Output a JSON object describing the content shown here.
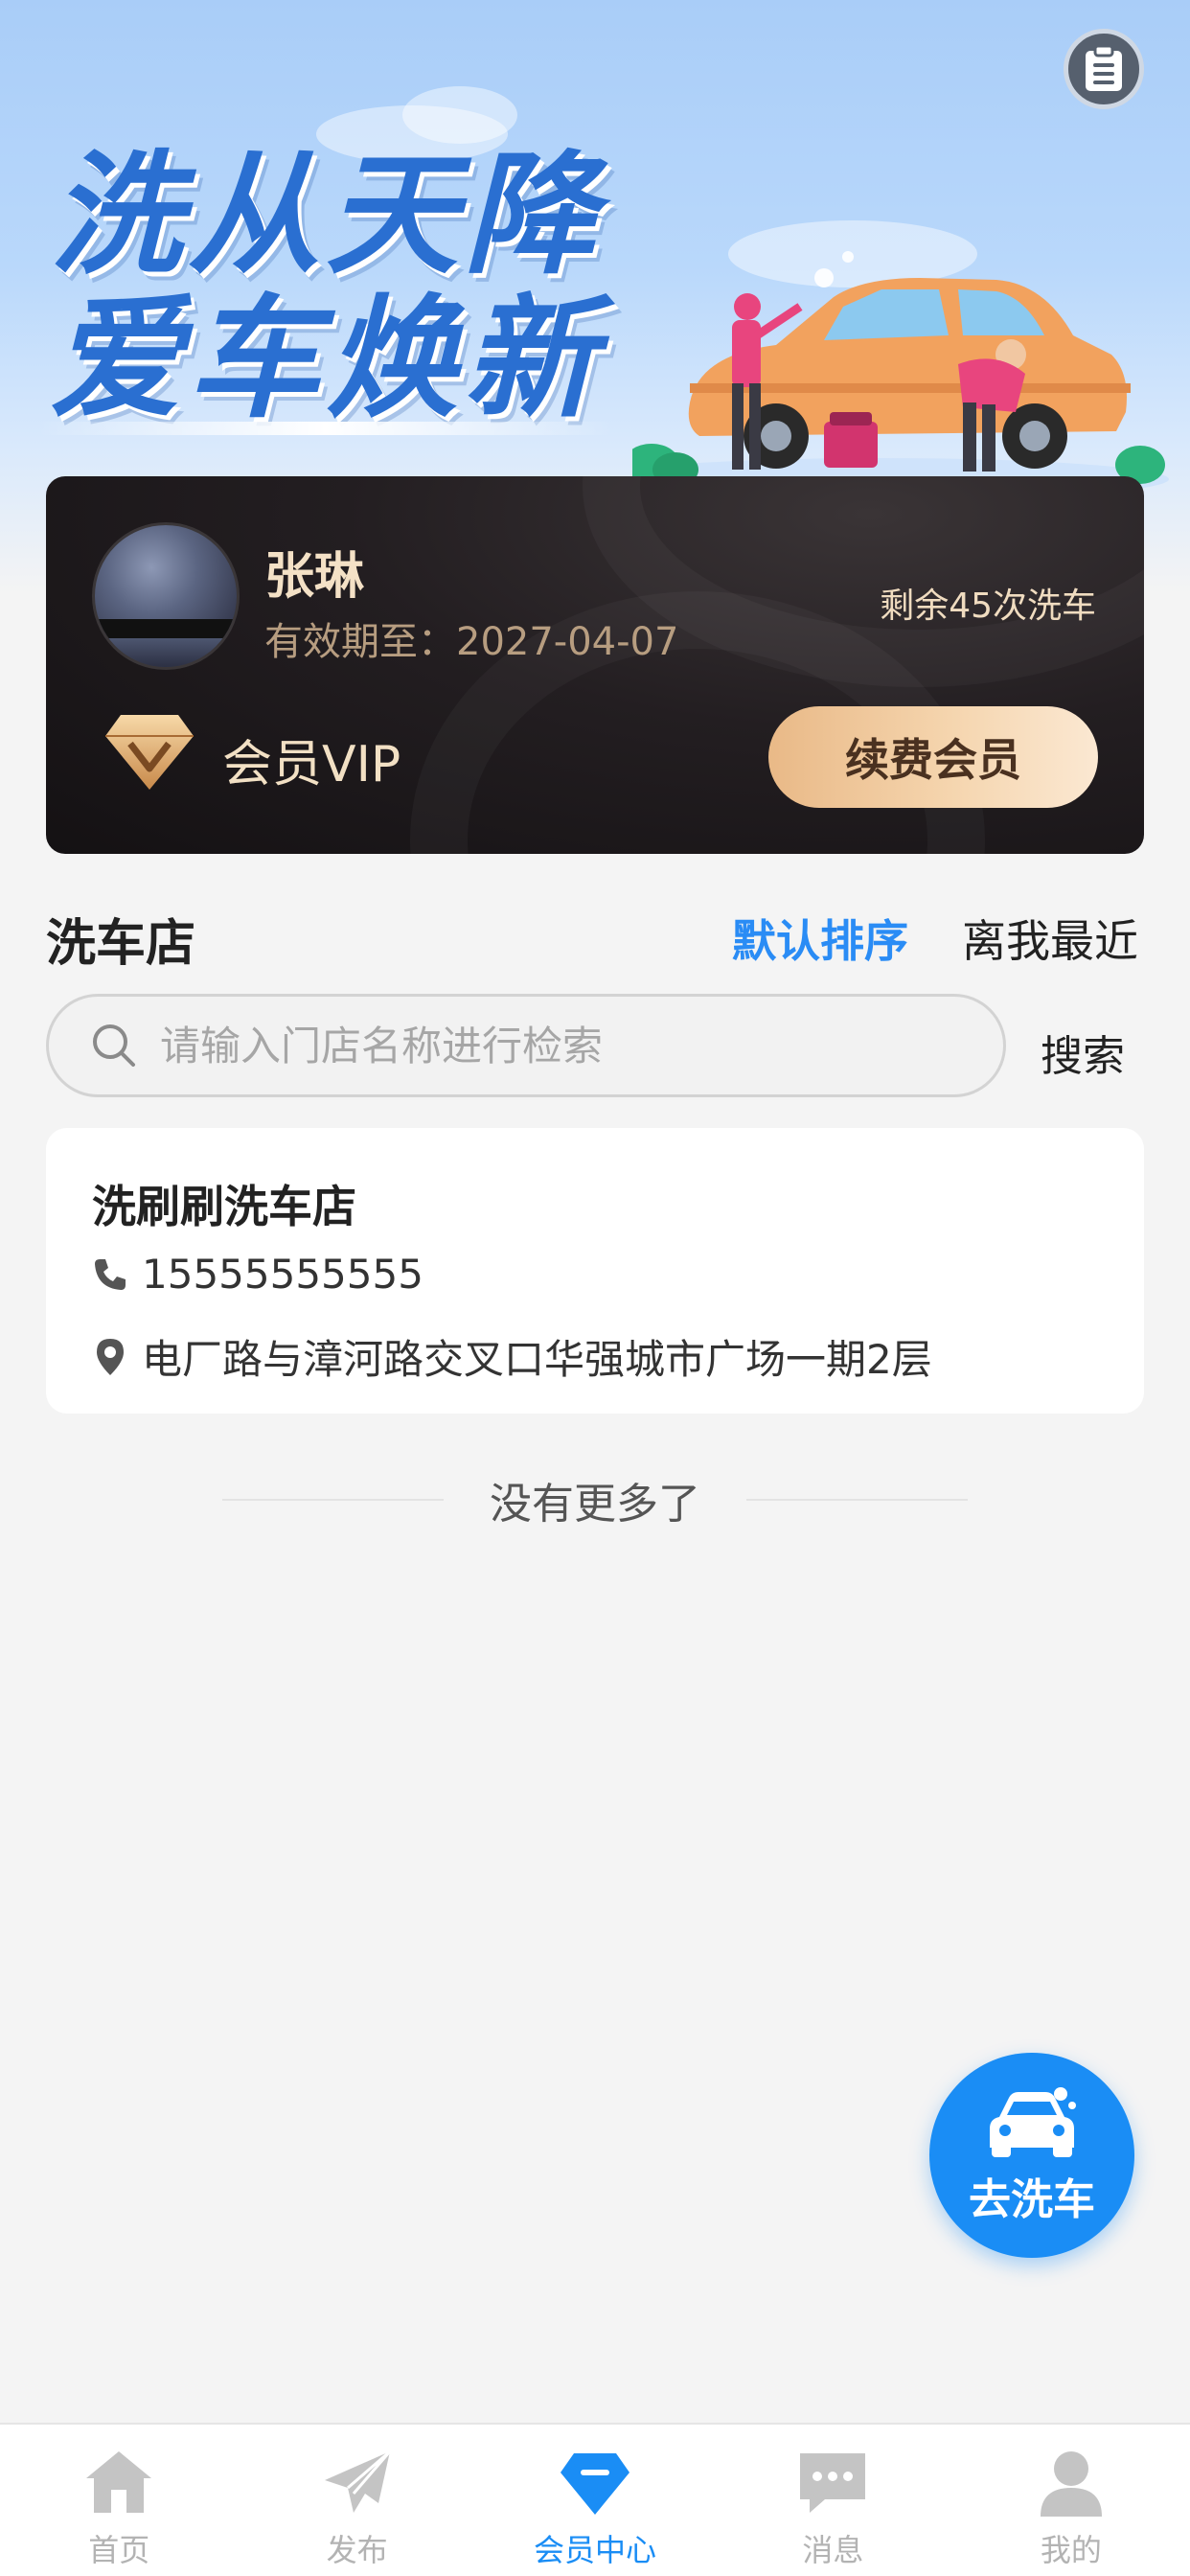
{
  "hero": {
    "title_line1": "洗从天降",
    "title_line2": "爱车焕新",
    "clipboard_icon": "clipboard-icon"
  },
  "member": {
    "name": "张琳",
    "expiry": "有效期至：2027-04-07",
    "remaining": "剩余45次洗车",
    "vip_label": "会员VIP",
    "renew_button": "续费会员"
  },
  "stores_section": {
    "title": "洗车店",
    "sort_default": "默认排序",
    "sort_nearest": "离我最近"
  },
  "search": {
    "placeholder": "请输入门店名称进行检索",
    "value": "",
    "button": "搜索"
  },
  "stores": [
    {
      "name": "洗刷刷洗车店",
      "phone": "15555555555",
      "address": "电厂路与漳河路交叉口华强城市广场一期2层"
    }
  ],
  "list_end_text": "没有更多了",
  "fab": {
    "label": "去洗车",
    "icon": "car-wash-icon"
  },
  "tabbar": {
    "items": [
      {
        "label": "首页",
        "icon": "home-icon"
      },
      {
        "label": "发布",
        "icon": "paper-plane-icon"
      },
      {
        "label": "会员中心",
        "icon": "diamond-icon"
      },
      {
        "label": "消息",
        "icon": "message-icon"
      },
      {
        "label": "我的",
        "icon": "user-icon"
      }
    ],
    "active_index": 2
  },
  "colors": {
    "accent": "#1a8df5",
    "sort_active": "#2a8cf5",
    "card_dark": "#1c181a",
    "gold_text": "#f2e0c4",
    "renew_gradient_start": "#e9b987",
    "renew_gradient_end": "#fbe8d2",
    "tab_inactive": "#b3b3b3"
  }
}
